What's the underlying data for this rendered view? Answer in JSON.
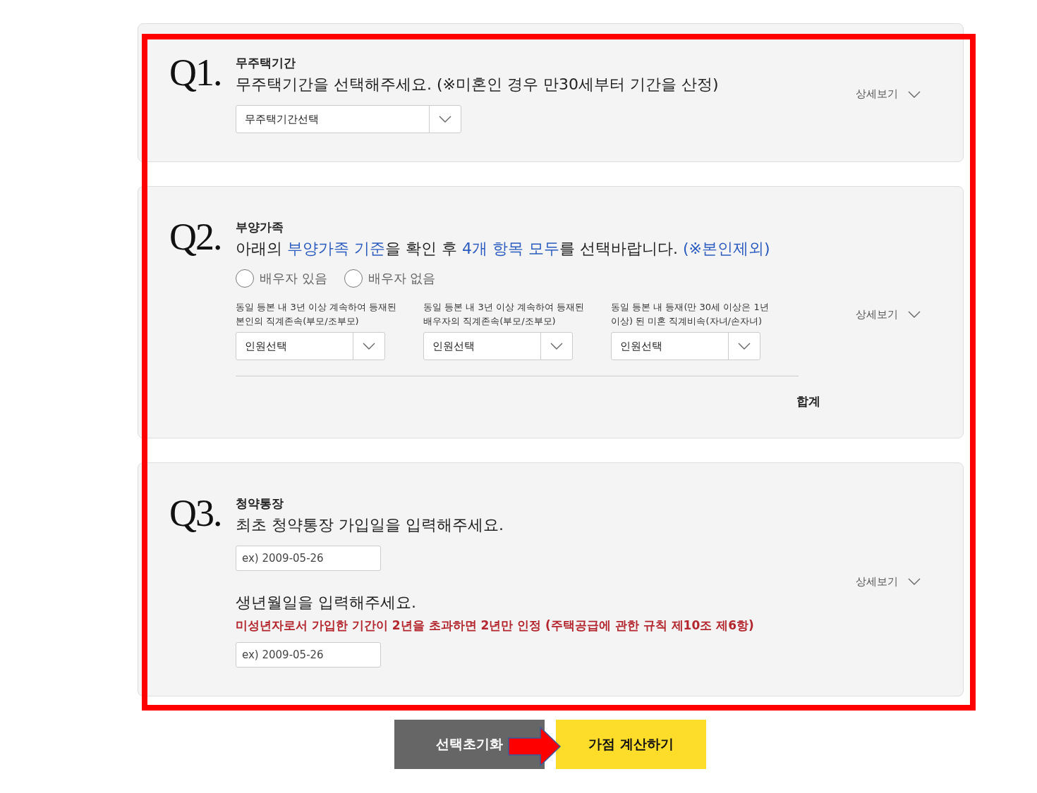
{
  "questions": [
    {
      "kind": "period",
      "number": "Q1.",
      "title": "무주택기간",
      "prompt": [
        {
          "text": "무주택기간을 선택해주세요. (※미혼인 경우 만30세부터 기간을 산정)",
          "highlight": false
        }
      ],
      "select": {
        "value": "무주택기간선택"
      },
      "detail_link": "상세보기"
    },
    {
      "kind": "family",
      "number": "Q2.",
      "title": "부양가족",
      "prompt": [
        {
          "text": "아래의 ",
          "highlight": false
        },
        {
          "text": "부양가족 기준",
          "highlight": true
        },
        {
          "text": "을 확인 후 ",
          "highlight": false
        },
        {
          "text": "4개 항목 모두",
          "highlight": true
        },
        {
          "text": "를 선택바랍니다. ",
          "highlight": false
        },
        {
          "text": "(※본인제외)",
          "highlight": true
        }
      ],
      "radios": [
        {
          "label": "배우자 있음",
          "selected": false
        },
        {
          "label": "배우자 없음",
          "selected": false
        }
      ],
      "dropdowns": [
        {
          "label": "동일 등본 내 3년 이상 계속하여 등재된 본인의 직계존속(부모/조부모)",
          "value": "인원선택"
        },
        {
          "label": "동일 등본 내 3년 이상 계속하여 등재된 배우자의 직계존속(부모/조부모)",
          "value": "인원선택"
        },
        {
          "label": "동일 등본 내 등재(만 30세 이상은 1년 이상) 된 미혼 직계비속(자녀/손자녀)",
          "value": "인원선택"
        }
      ],
      "total_label": "합계",
      "detail_link": "상세보기"
    },
    {
      "kind": "account",
      "number": "Q3.",
      "title": "청약통장",
      "prompt": [
        {
          "text": "최초 청약통장 가입일을 입력해주세요.",
          "highlight": false
        }
      ],
      "join_date": {
        "placeholder": "ex) 2009-05-26"
      },
      "birth_prompt": "생년월일을 입력해주세요.",
      "note": "미성년자로서 가입한 기간이 2년을 초과하면 2년만 인정 (주택공급에 관한 규칙 제10조 제6항)",
      "birth_date": {
        "placeholder": "ex) 2009-05-26"
      },
      "detail_link": "상세보기"
    }
  ],
  "buttons": [
    {
      "kind": "reset",
      "label": "선택초기화"
    },
    {
      "kind": "calculate",
      "label": "가점 계산하기"
    }
  ]
}
